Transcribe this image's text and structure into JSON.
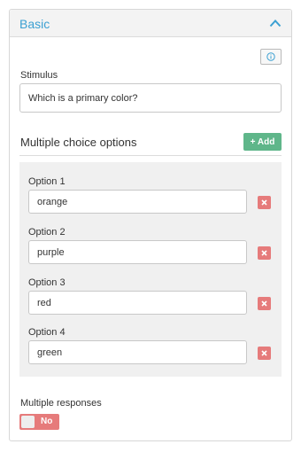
{
  "panel": {
    "title": "Basic",
    "collapse_icon": "chevron-up-icon",
    "info_icon": "info-icon",
    "accent_color": "#3ba0d2"
  },
  "stimulus": {
    "label": "Stimulus",
    "value": "Which is a primary color?"
  },
  "choices": {
    "heading": "Multiple choice options",
    "add_label": "+ Add",
    "add_color": "#5fb68a",
    "remove_color": "#e67b7b",
    "remove_icon": "close-icon",
    "options": [
      {
        "label": "Option 1",
        "value": "orange"
      },
      {
        "label": "Option 2",
        "value": "purple"
      },
      {
        "label": "Option 3",
        "value": "red"
      },
      {
        "label": "Option 4",
        "value": "green"
      }
    ]
  },
  "multiple_responses": {
    "label": "Multiple responses",
    "state": "No"
  }
}
